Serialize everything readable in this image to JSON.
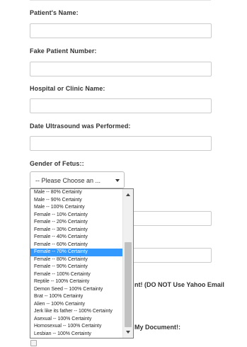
{
  "form": {
    "patient_name_label": "Patient's Name:",
    "fake_patient_number_label": "Fake Patient Number:",
    "hospital_label": "Hospital or Clinic Name:",
    "date_label": "Date Ultrasound was Performed:",
    "gender_label": "Gender of Fetus::",
    "gender_select_value": "-- Please Choose an ...",
    "email_partial_text": "nt! (DO NOT Use Yahoo Email",
    "document_partial_text": "My Document!:"
  },
  "dropdown": {
    "options": [
      "Male -- 80% Certainty",
      "Male -- 90% Certainty",
      "Male -- 100% Certainty",
      "Female -- 10% Certainty",
      "Female -- 20% Certainty",
      "Female -- 30% Certainty",
      "Female -- 40% Certainty",
      "Female -- 60% Certainty",
      "Female -- 70% Certainty",
      "Female -- 80% Certainty",
      "Female -- 90% Certainty",
      "Female -- 100% Certainty",
      "Reptile -- 100% Certainty",
      "Demon Seed -- 100% Certainty",
      "Brat -- 100% Certainty",
      "Alien -- 100% Certainty",
      "Jerk like its father -- 100% Certainty",
      "Asexual -- 100% Certainty",
      "Homosexual -- 100% Certainty",
      "Lesbian -- 100% Certainty"
    ],
    "selected_index": 8,
    "selected_color": "#3399ff"
  }
}
